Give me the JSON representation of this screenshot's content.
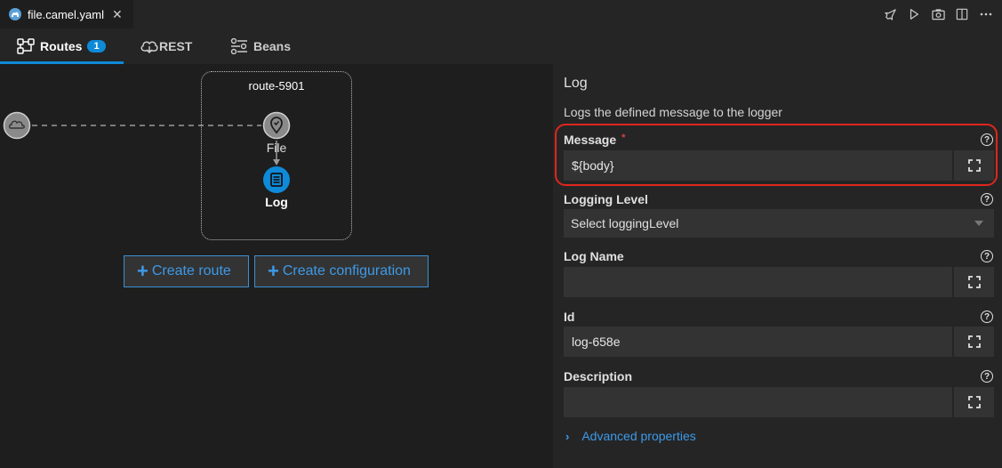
{
  "editor": {
    "file_tab": {
      "name": "file.camel.yaml",
      "close_glyph": "✕",
      "icon": "camel-file-icon"
    },
    "actions": [
      "rocket-icon",
      "run-icon",
      "camera-icon",
      "split-editor-icon",
      "more-icon"
    ]
  },
  "subtabs": [
    {
      "label": "Routes",
      "badge": "1",
      "icon": "routes-icon",
      "active": true
    },
    {
      "label": "REST",
      "icon": "cloud-icon"
    },
    {
      "label": "Beans",
      "icon": "beans-icon"
    }
  ],
  "canvas": {
    "route_name": "route-5901",
    "nodes": [
      {
        "label": "File",
        "icon": "file-endpoint-icon"
      },
      {
        "label": "Log",
        "icon": "log-icon",
        "selected": true
      }
    ],
    "buttons": {
      "create_route": "Create route",
      "create_configuration": "Create configuration"
    }
  },
  "panel": {
    "title": "Log",
    "description": "Logs the defined message to the logger",
    "fields": {
      "message": {
        "label": "Message",
        "required_mark": "*",
        "value": "${body}"
      },
      "logging_level": {
        "label": "Logging Level",
        "placeholder": "Select loggingLevel"
      },
      "log_name": {
        "label": "Log Name",
        "value": ""
      },
      "id": {
        "label": "Id",
        "value": "log-658e"
      },
      "description": {
        "label": "Description",
        "value": ""
      }
    },
    "help_glyph": "?",
    "advanced": {
      "chevron": "›",
      "label": "Advanced properties"
    }
  },
  "colors": {
    "accent": "#0e8ad8",
    "highlight": "#e0261c",
    "panel_bg": "#252526",
    "canvas_bg": "#1e1e1e"
  }
}
